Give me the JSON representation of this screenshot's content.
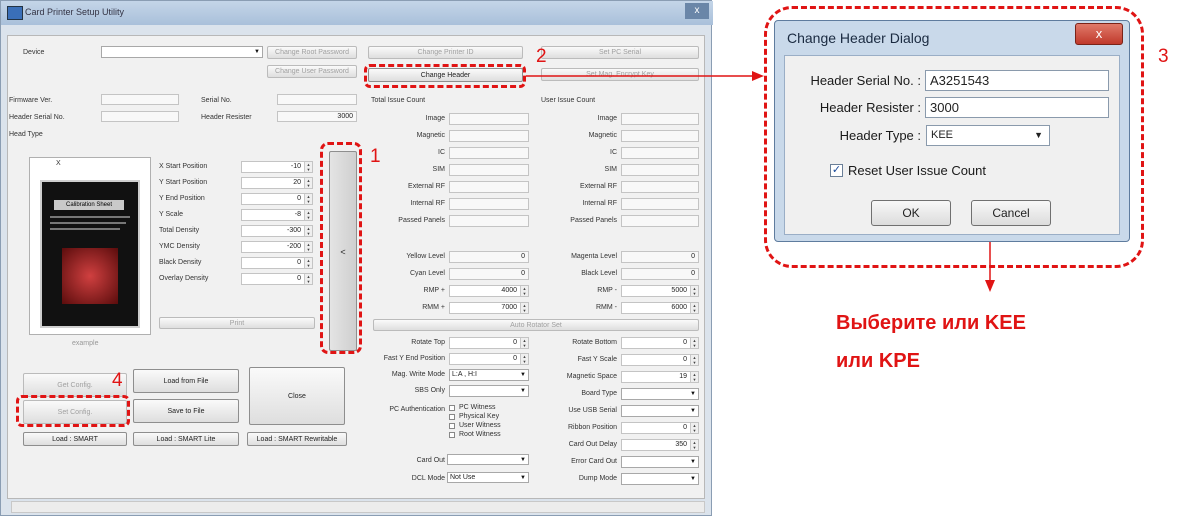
{
  "main_window": {
    "title": "Card Printer Setup Utility",
    "close_glyph": "x",
    "device": {
      "label": "Device",
      "value": ""
    },
    "buttons": {
      "change_root_password": "Change Root Password",
      "change_user_password": "Change User Password",
      "change_printer_id": "Change Printer ID",
      "set_pc_serial": "Set PC Serial",
      "change_header": "Change Header",
      "set_mag_encrypt_key": "Set Mag. Encrypt Key",
      "print": "Print",
      "get_config": "Get Config.",
      "load_from_file": "Load from File",
      "close": "Close",
      "set_config": "Set Config.",
      "save_to_file": "Save to File",
      "load_smart": "Load : SMART",
      "load_smart_lite": "Load : SMART Lite",
      "load_smart_rewritable": "Load : SMART Rewritable",
      "auto_rotator_set": "Auto Rotator Set",
      "collapse": "<"
    },
    "info": {
      "firmware_ver": "Firmware Ver.",
      "serial_no": "Serial No.",
      "header_serial_no": "Header Serial No.",
      "header_resister": "Header Resister",
      "header_resister_value": "3000",
      "head_type": "Head Type"
    },
    "preview": {
      "axis_x": "X",
      "card_title": "Calibration Sheet",
      "caption": "example"
    },
    "positions": [
      {
        "label": "X Start Position",
        "value": "-10"
      },
      {
        "label": "Y Start Position",
        "value": "20"
      },
      {
        "label": "Y End Position",
        "value": "0"
      },
      {
        "label": "Y Scale",
        "value": "-8"
      },
      {
        "label": "Total Density",
        "value": "-300"
      },
      {
        "label": "YMC Density",
        "value": "-200"
      },
      {
        "label": "Black Density",
        "value": "0"
      },
      {
        "label": "Overlay Density",
        "value": "0"
      }
    ],
    "total_issue_count": {
      "title": "Total Issue Count",
      "items": [
        "Image",
        "Magnetic",
        "IC",
        "SIM",
        "External RF",
        "Internal RF",
        "Passed Panels"
      ]
    },
    "user_issue_count": {
      "title": "User Issue Count",
      "items": [
        "Image",
        "Magnetic",
        "IC",
        "SIM",
        "External RF",
        "Internal RF",
        "Passed Panels"
      ]
    },
    "levels_left": [
      {
        "label": "Yellow Level",
        "value": "0"
      },
      {
        "label": "Cyan Level",
        "value": "0"
      },
      {
        "label": "RMP +",
        "value": "4000"
      },
      {
        "label": "RMM +",
        "value": "7000"
      }
    ],
    "levels_right": [
      {
        "label": "Magenta Level",
        "value": "0"
      },
      {
        "label": "Black Level",
        "value": "0"
      },
      {
        "label": "RMP -",
        "value": "5000"
      },
      {
        "label": "RMM -",
        "value": "6000"
      }
    ],
    "settings_left": [
      {
        "label": "Rotate Top",
        "value": "0",
        "kind": "spin"
      },
      {
        "label": "Fast Y End Position",
        "value": "0",
        "kind": "spin"
      },
      {
        "label": "Mag. Write Mode",
        "value": "L:A , H:I",
        "kind": "combo"
      },
      {
        "label": "SBS Only",
        "value": "",
        "kind": "combo"
      }
    ],
    "settings_right": [
      {
        "label": "Rotate Bottom",
        "value": "0",
        "kind": "spin"
      },
      {
        "label": "Fast Y Scale",
        "value": "0",
        "kind": "spin"
      },
      {
        "label": "Magnetic Space",
        "value": "19",
        "kind": "spin"
      },
      {
        "label": "Board Type",
        "value": "",
        "kind": "combo"
      },
      {
        "label": "Use USB Serial",
        "value": "",
        "kind": "combo"
      },
      {
        "label": "Ribbon Position",
        "value": "0",
        "kind": "spin"
      },
      {
        "label": "Card Out Delay",
        "value": "350",
        "kind": "spin"
      },
      {
        "label": "Error Card Out",
        "value": "",
        "kind": "combo"
      },
      {
        "label": "Dump Mode",
        "value": "",
        "kind": "combo"
      }
    ],
    "pc_authentication": {
      "label": "PC Authentication",
      "options": [
        "PC Witness",
        "Physical Key",
        "User Witness",
        "Root Witness"
      ]
    },
    "card_out": {
      "label": "Card Out",
      "value": ""
    },
    "dcl_mode": {
      "label": "DCL Mode",
      "value": "Not Use"
    }
  },
  "dialog": {
    "title": "Change Header Dialog",
    "close_glyph": "x",
    "header_serial_label": "Header Serial No. :",
    "header_serial_value": "A3251543",
    "header_resister_label": "Header Resister :",
    "header_resister_value": "3000",
    "header_type_label": "Header Type :",
    "header_type_value": "KEE",
    "reset_label": "Reset User Issue Count",
    "reset_checked": true,
    "ok": "OK",
    "cancel": "Cancel"
  },
  "annotations": {
    "num1": "1",
    "num2": "2",
    "num3": "3",
    "num4": "4",
    "note_line1": "Выберите или KEE",
    "note_line2": "или KPE",
    "accent_color": "#e01414"
  }
}
